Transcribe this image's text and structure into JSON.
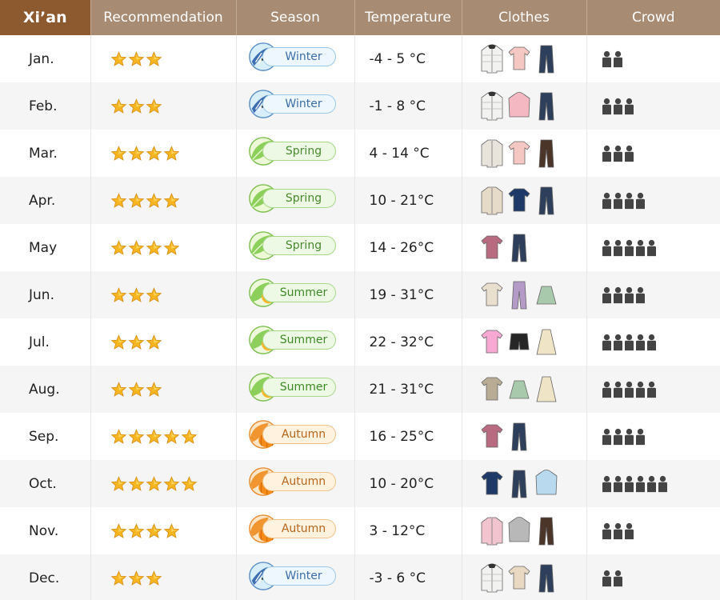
{
  "city": "Xi’an",
  "headers": [
    "Recommendation",
    "Season",
    "Temperature",
    "Clothes",
    "Crowd"
  ],
  "season_labels": {
    "winter": "Winter",
    "spring": "Spring",
    "summer": "Summer",
    "autumn": "Autumn"
  },
  "rows": [
    {
      "month": "Jan.",
      "stars": 3,
      "season": "winter",
      "temp": "-4 - 5 °C",
      "clothes": [
        "white-down-jacket",
        "pink-sweater",
        "navy-jeans"
      ],
      "crowd": 2
    },
    {
      "month": "Feb.",
      "stars": 3,
      "season": "winter",
      "temp": "-1 - 8 °C",
      "clothes": [
        "white-down-jacket",
        "pink-hoodie",
        "navy-jeans"
      ],
      "crowd": 3
    },
    {
      "month": "Mar.",
      "stars": 4,
      "season": "spring",
      "temp": "4 - 14 °C",
      "clothes": [
        "black-white-jacket",
        "pink-sweater",
        "brown-pants"
      ],
      "crowd": 3
    },
    {
      "month": "Apr.",
      "stars": 4,
      "season": "spring",
      "temp": "10 - 21°C",
      "clothes": [
        "beige-trench-coat",
        "navy-sweater",
        "navy-jeans"
      ],
      "crowd": 4
    },
    {
      "month": "May",
      "stars": 4,
      "season": "spring",
      "temp": "14 - 26°C",
      "clothes": [
        "mauve-shirt",
        "navy-jeans"
      ],
      "crowd": 5
    },
    {
      "month": "Jun.",
      "stars": 3,
      "season": "summer",
      "temp": "19 - 31°C",
      "clothes": [
        "beige-polo",
        "lilac-pants",
        "green-skirt"
      ],
      "crowd": 4
    },
    {
      "month": "Jul.",
      "stars": 3,
      "season": "summer",
      "temp": "22 - 32°C",
      "clothes": [
        "pink-tshirt",
        "black-shorts",
        "cream-dress"
      ],
      "crowd": 5
    },
    {
      "month": "Aug.",
      "stars": 3,
      "season": "summer",
      "temp": "21 - 31°C",
      "clothes": [
        "khaki-tshirt",
        "green-skirt",
        "cream-dress"
      ],
      "crowd": 5
    },
    {
      "month": "Sep.",
      "stars": 5,
      "season": "autumn",
      "temp": "16 - 25°C",
      "clothes": [
        "mauve-shirt",
        "navy-jeans"
      ],
      "crowd": 4
    },
    {
      "month": "Oct.",
      "stars": 5,
      "season": "autumn",
      "temp": "10 - 20°C",
      "clothes": [
        "navy-sweater",
        "navy-jeans",
        "light-blue-hoodie"
      ],
      "crowd": 6
    },
    {
      "month": "Nov.",
      "stars": 4,
      "season": "autumn",
      "temp": "3 - 12°C",
      "clothes": [
        "pink-jacket",
        "grey-hoodie",
        "brown-pants"
      ],
      "crowd": 3
    },
    {
      "month": "Dec.",
      "stars": 3,
      "season": "winter",
      "temp": "-3 - 6 °C",
      "clothes": [
        "white-down-jacket",
        "beige-sweater",
        "navy-jeans"
      ],
      "crowd": 2
    }
  ],
  "colors": {
    "header": "#a78c73",
    "city_header": "#8c5a2e",
    "alt_row": "#f5f5f5",
    "star": "#f7b521",
    "crowd_icon": "#444444"
  }
}
